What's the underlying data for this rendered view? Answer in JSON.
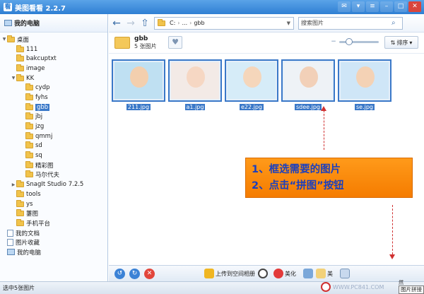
{
  "window": {
    "title": "美图看看 2.2.7",
    "app_icon": "看"
  },
  "sidebar": {
    "header": "我的电脑",
    "tree": [
      {
        "label": "桌面",
        "depth": 0,
        "icon": "folder-icon",
        "expander": "▼"
      },
      {
        "label": "111",
        "depth": 1,
        "icon": "folder-icon",
        "expander": ""
      },
      {
        "label": "bakcuptxt",
        "depth": 1,
        "icon": "folder-icon",
        "expander": ""
      },
      {
        "label": "image",
        "depth": 1,
        "icon": "folder-icon",
        "expander": ""
      },
      {
        "label": "KK",
        "depth": 1,
        "icon": "folder-icon",
        "expander": "▼"
      },
      {
        "label": "cydp",
        "depth": 2,
        "icon": "folder-icon",
        "expander": ""
      },
      {
        "label": "fyhs",
        "depth": 2,
        "icon": "folder-icon",
        "expander": ""
      },
      {
        "label": "gbb",
        "depth": 2,
        "icon": "folder-icon",
        "expander": "",
        "selected": true
      },
      {
        "label": "jbj",
        "depth": 2,
        "icon": "folder-icon",
        "expander": ""
      },
      {
        "label": "jzg",
        "depth": 2,
        "icon": "folder-icon",
        "expander": ""
      },
      {
        "label": "qmmj",
        "depth": 2,
        "icon": "folder-icon",
        "expander": ""
      },
      {
        "label": "sd",
        "depth": 2,
        "icon": "folder-icon",
        "expander": ""
      },
      {
        "label": "sq",
        "depth": 2,
        "icon": "folder-icon",
        "expander": ""
      },
      {
        "label": "精彩图",
        "depth": 2,
        "icon": "folder-icon",
        "expander": ""
      },
      {
        "label": "马尔代夫",
        "depth": 2,
        "icon": "folder-icon",
        "expander": ""
      },
      {
        "label": "SnagIt Studio 7.2.5",
        "depth": 1,
        "icon": "folder-icon",
        "expander": "▶"
      },
      {
        "label": "tools",
        "depth": 1,
        "icon": "folder-icon",
        "expander": ""
      },
      {
        "label": "ys",
        "depth": 1,
        "icon": "folder-icon",
        "expander": ""
      },
      {
        "label": "萋图",
        "depth": 1,
        "icon": "folder-icon",
        "expander": ""
      },
      {
        "label": "手机平台",
        "depth": 1,
        "icon": "folder-icon",
        "expander": ""
      },
      {
        "label": "我的文档",
        "depth": 0,
        "icon": "doc-icon",
        "expander": ""
      },
      {
        "label": "图片收藏",
        "depth": 0,
        "icon": "doc-icon",
        "expander": ""
      },
      {
        "label": "我的电脑",
        "depth": 0,
        "icon": "pc-icon",
        "expander": ""
      }
    ]
  },
  "nav": {
    "path": [
      "C:",
      "...",
      "gbb"
    ],
    "search_placeholder": "搜索图片"
  },
  "folder": {
    "name": "gbb",
    "count": "5 张图片",
    "sort_label": "排序",
    "zoom_level": 0.25
  },
  "thumbnails": [
    {
      "name": "211.jpg",
      "bg": "#bfe0f2",
      "head": "#f3cfae"
    },
    {
      "name": "a1.jpg",
      "bg": "#f3eae6",
      "head": "#f6d7c3"
    },
    {
      "name": "e22.jpg",
      "bg": "#d6ecf8",
      "head": "#f5d6bb"
    },
    {
      "name": "sdee.jpg",
      "bg": "#eef2f6",
      "head": "#f2d0b8"
    },
    {
      "name": "se.jpg",
      "bg": "#cfe6f7",
      "head": "#f4d2b5"
    }
  ],
  "callout": {
    "line1": "1、框选需要的图片",
    "line2": "2、点击“拼图”按钮"
  },
  "bottombar": {
    "upload_label": "上传到空间相册",
    "beautify_label": "美化",
    "other_label": "美"
  },
  "status": {
    "text": "选中5张图片"
  },
  "watermark": {
    "text": "WWW.PC841.COM"
  },
  "tooltip": {
    "label": "图片拼接",
    "top_label": "然"
  }
}
